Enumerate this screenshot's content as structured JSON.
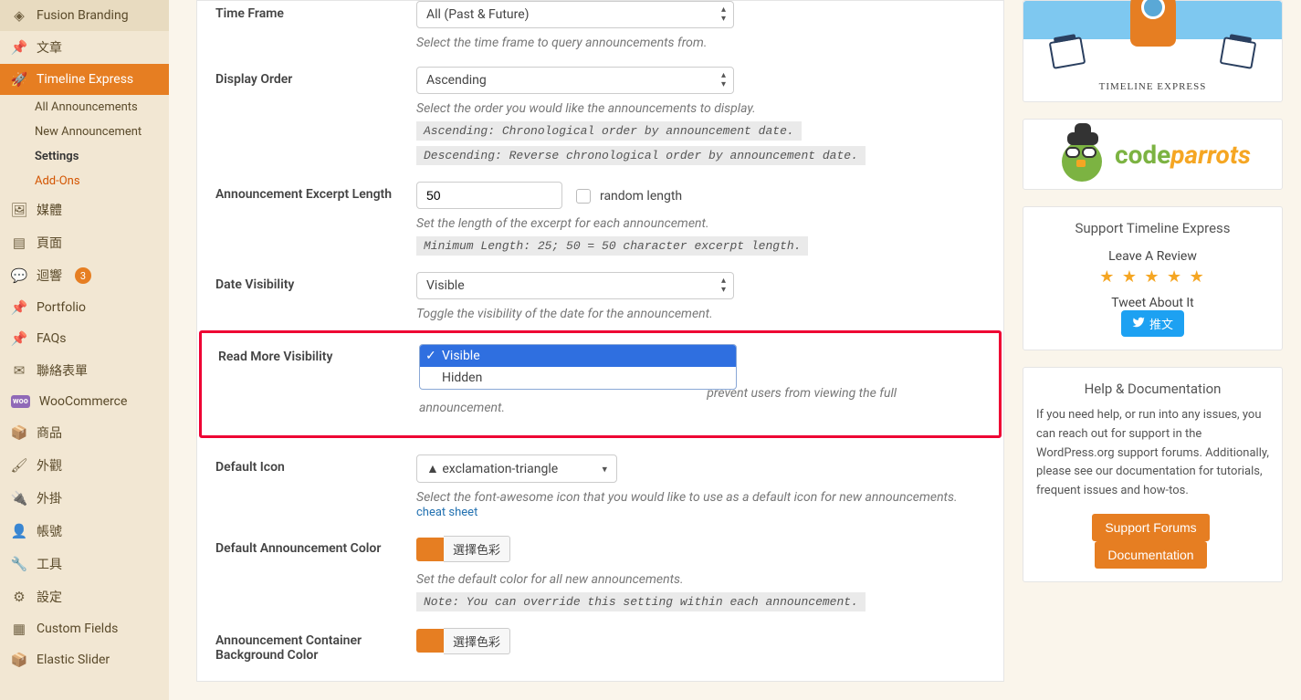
{
  "sidebar": {
    "items": [
      {
        "label": "Fusion Branding",
        "icon": "fusion"
      },
      {
        "label": "文章",
        "icon": "pin"
      },
      {
        "label": "Timeline Express",
        "icon": "rocket",
        "active": true,
        "subs": [
          {
            "label": "All Announcements"
          },
          {
            "label": "New Announcement"
          },
          {
            "label": "Settings",
            "bold": true
          },
          {
            "label": "Add-Ons",
            "highlight": true
          }
        ]
      },
      {
        "label": "媒體",
        "icon": "media"
      },
      {
        "label": "頁面",
        "icon": "page"
      },
      {
        "label": "迴響",
        "icon": "comment",
        "badge": "3"
      },
      {
        "label": "Portfolio",
        "icon": "pin"
      },
      {
        "label": "FAQs",
        "icon": "pin"
      },
      {
        "label": "聯絡表單",
        "icon": "envelope"
      },
      {
        "label": "WooCommerce",
        "icon": "woo"
      },
      {
        "label": "商品",
        "icon": "cube"
      },
      {
        "label": "外觀",
        "icon": "brush"
      },
      {
        "label": "外掛",
        "icon": "plug"
      },
      {
        "label": "帳號",
        "icon": "user"
      },
      {
        "label": "工具",
        "icon": "wrench"
      },
      {
        "label": "設定",
        "icon": "sliders"
      },
      {
        "label": "Custom Fields",
        "icon": "grid"
      },
      {
        "label": "Elastic Slider",
        "icon": "cube"
      }
    ]
  },
  "fields": {
    "timeFrame": {
      "label": "Time Frame",
      "value": "All (Past & Future)",
      "help": "Select the time frame to query announcements from."
    },
    "displayOrder": {
      "label": "Display Order",
      "value": "Ascending",
      "help": "Select the order you would like the announcements to display.",
      "code1": "Ascending: Chronological order by announcement date.",
      "code2": "Descending: Reverse chronological order by announcement date."
    },
    "excerptLength": {
      "label": "Announcement Excerpt Length",
      "value": "50",
      "checkboxLabel": "random length",
      "help": "Set the length of the excerpt for each announcement.",
      "code": "Minimum Length: 25; 50 = 50 character excerpt length."
    },
    "dateVisibility": {
      "label": "Date Visibility",
      "value": "Visible",
      "help": "Toggle the visibility of the date for the announcement."
    },
    "readMore": {
      "label": "Read More Visibility",
      "options": [
        "Visible",
        "Hidden"
      ],
      "helpTail": " prevent users from viewing the full announcement."
    },
    "defaultIcon": {
      "label": "Default Icon",
      "value": "exclamation-triangle",
      "help": "Select the font-awesome icon that you would like to use as a default icon for new announcements.",
      "cheatLink": "cheat sheet"
    },
    "defaultColor": {
      "label": "Default Announcement Color",
      "btn": "選擇色彩",
      "help": "Set the default color for all new announcements.",
      "code": "Note: You can override this setting within each announcement."
    },
    "containerBg": {
      "label": "Announcement Container Background Color",
      "btn": "選擇色彩"
    }
  },
  "right": {
    "rocketLabel": "TIMELINE EXPRESS",
    "codeparrots": {
      "code": "code",
      "parrots": "parrots"
    },
    "support": {
      "title": "Support Timeline Express",
      "review": "Leave A Review",
      "tweetAbout": "Tweet About It",
      "tweetBtn": "推文"
    },
    "docs": {
      "title": "Help & Documentation",
      "text": "If you need help, or run into any issues, you can reach out for support in the WordPress.org support forums. Additionally, please see our documentation for tutorials, frequent issues and how-tos.",
      "btn1": "Support Forums",
      "btn2": "Documentation"
    }
  }
}
